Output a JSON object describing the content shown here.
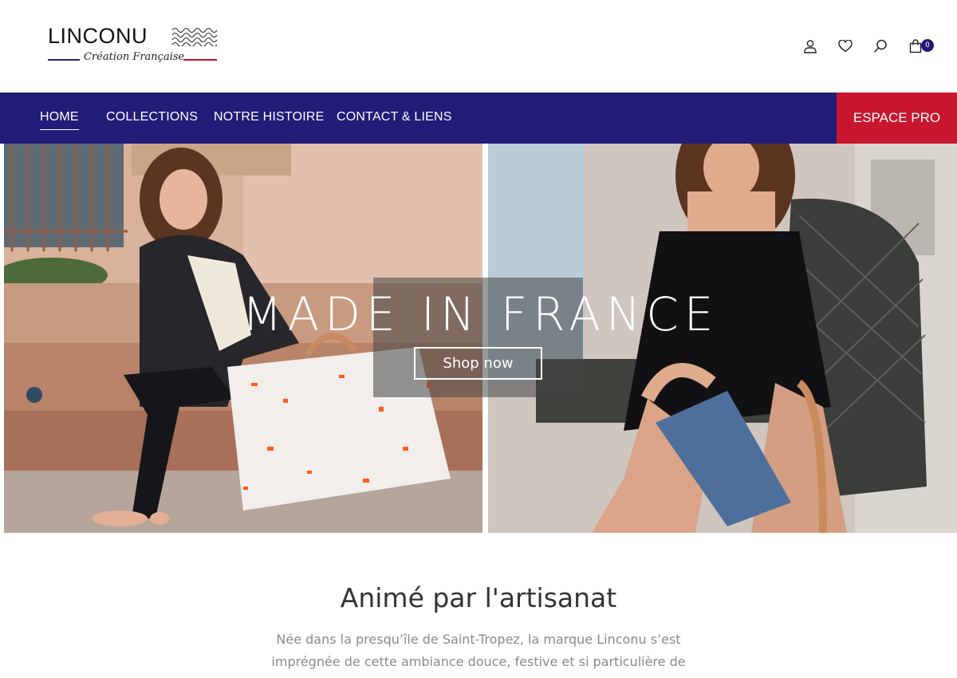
{
  "brand": {
    "name": "LINCONU",
    "tagline": "Création Française"
  },
  "header_icons": {
    "account": "user-icon",
    "wishlist": "heart-icon",
    "search": "search-icon",
    "cart": "shopping-bag-icon",
    "cart_count": "0"
  },
  "nav": {
    "items": [
      {
        "label": "HOME",
        "active": true
      },
      {
        "label": "COLLECTIONS",
        "active": false
      },
      {
        "label": "NOTRE HISTOIRE",
        "active": false
      },
      {
        "label": "CONTACT & LIENS",
        "active": false
      }
    ],
    "espace_pro": "ESPACE PRO"
  },
  "hero": {
    "title": "MADE IN FRANCE",
    "button": "Shop now"
  },
  "section": {
    "title": "Animé par l'artisanat",
    "text": "Née dans la presqu’île de Saint-Tropez, la marque Linconu s’est imprégnée de cette ambiance douce, festive et si particulière de"
  },
  "colors": {
    "nav_bg": "#201c78",
    "espace_pro_bg": "#c7162e",
    "badge_bg": "#1f1a78",
    "flag_blue": "#1f2473",
    "flag_red": "#c8102e"
  }
}
